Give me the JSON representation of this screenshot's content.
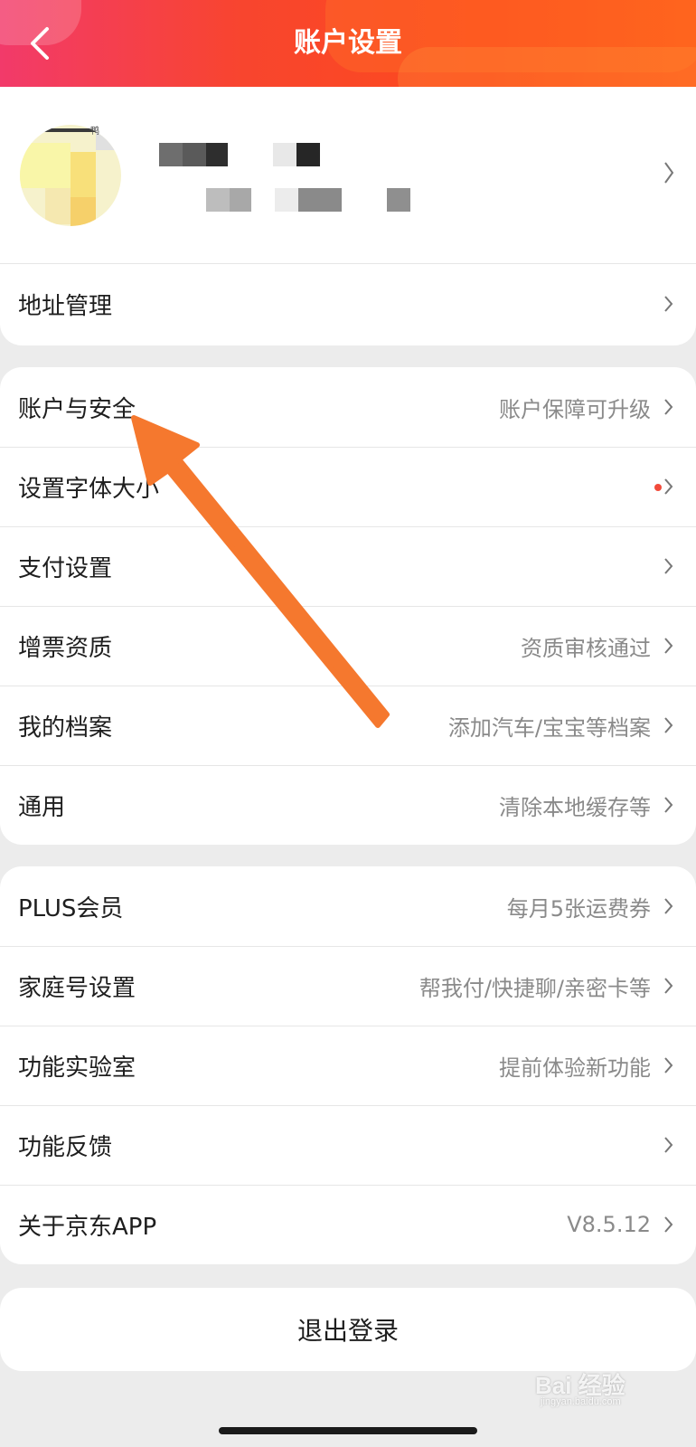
{
  "header": {
    "title": "账户设置",
    "gradient_colors": [
      "#f23a6a",
      "#fd4a1c",
      "#ff5a1a"
    ]
  },
  "profile": {
    "avatar_tag": "鸭"
  },
  "address_item": {
    "label": "地址管理"
  },
  "settings_group": [
    {
      "label": "账户与安全",
      "value": "账户保障可升级"
    },
    {
      "label": "设置字体大小",
      "value": ""
    },
    {
      "label": "支付设置",
      "value": ""
    },
    {
      "label": "增票资质",
      "value": "资质审核通过"
    },
    {
      "label": "我的档案",
      "value": "添加汽车/宝宝等档案"
    },
    {
      "label": "通用",
      "value": "清除本地缓存等"
    }
  ],
  "more_group": [
    {
      "label": "PLUS会员",
      "value": "每月5张运费券"
    },
    {
      "label": "家庭号设置",
      "value": "帮我付/快捷聊/亲密卡等"
    },
    {
      "label": "功能实验室",
      "value": "提前体验新功能"
    },
    {
      "label": "功能反馈",
      "value": ""
    },
    {
      "label": "关于京东APP",
      "value": "V8.5.12"
    }
  ],
  "logout_label": "退出登录",
  "watermark": {
    "text": "Bai 经验",
    "sub": "jingyan.baidu.com"
  },
  "colors": {
    "annotation_arrow": "#f5782e",
    "notification_dot": "#f24a3a",
    "background": "#ececec"
  }
}
